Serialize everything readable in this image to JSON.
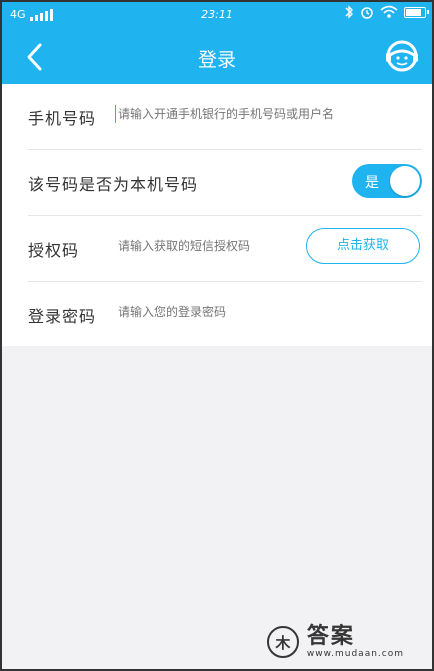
{
  "status_bar": {
    "network": "4G",
    "time": "23:11"
  },
  "nav": {
    "title": "登录"
  },
  "form": {
    "phone": {
      "label": "手机号码",
      "placeholder": "请输入开通手机银行的手机号码或用户名"
    },
    "is_own_number": {
      "label": "该号码是否为本机号码",
      "toggle_text": "是",
      "on": true
    },
    "auth_code": {
      "label": "授权码",
      "placeholder": "请输入获取的短信授权码",
      "button": "点击获取"
    },
    "password": {
      "label": "登录密码",
      "placeholder": "请输入您的登录密码"
    }
  },
  "watermark": {
    "logo_char": "木",
    "title": "答案",
    "url": "www.mudaan.com"
  },
  "colors": {
    "accent": "#1fb3ef",
    "background": "#f2f2f4"
  }
}
